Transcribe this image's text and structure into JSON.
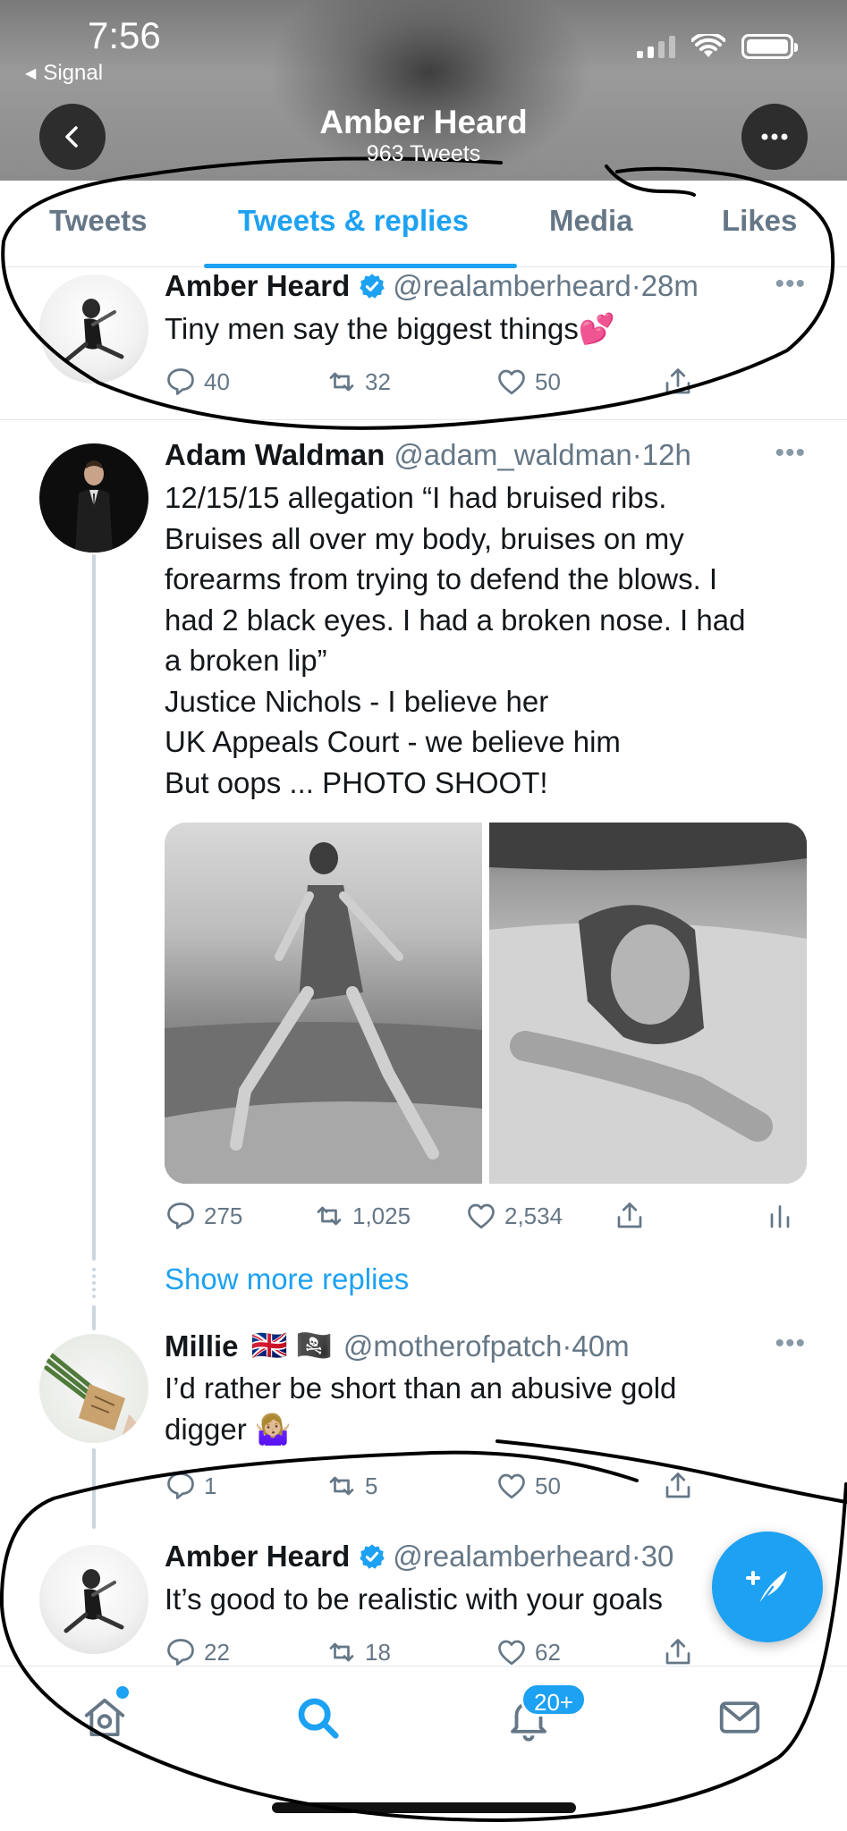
{
  "status_bar": {
    "time": "7:56",
    "back_app": "Signal"
  },
  "header": {
    "name": "Amber Heard",
    "tweet_count": "963 Tweets"
  },
  "tabs": [
    {
      "label": "Tweets",
      "active": false
    },
    {
      "label": "Tweets & replies",
      "active": true
    },
    {
      "label": "Media",
      "active": false
    },
    {
      "label": "Likes",
      "active": false
    }
  ],
  "tweets": [
    {
      "name": "Amber Heard",
      "verified": true,
      "handle": "@realamberheard",
      "time": "28m",
      "text": [
        "Tiny men say the biggest things💕"
      ],
      "replies": "40",
      "retweets": "32",
      "likes": "50"
    },
    {
      "name": "Adam Waldman",
      "verified": false,
      "handle": "@adam_waldman",
      "time": "12h",
      "text": [
        "12/15/15 allegation “I had bruised ribs.",
        "Bruises all over my body, bruises on my",
        "forearms from trying to defend the blows. I",
        "had 2 black eyes. I had a broken nose. I had",
        "a broken lip”",
        "Justice Nichols - I believe her",
        "UK Appeals Court - we believe him",
        "But oops ... PHOTO SHOOT!"
      ],
      "replies": "275",
      "retweets": "1,025",
      "likes": "2,534"
    },
    {
      "name": "Millie",
      "flags": "🇬🇧 🏴‍☠️",
      "verified": false,
      "handle": "@motherofpatch",
      "time": "40m",
      "text": [
        "I’d rather be short than an abusive gold",
        "digger 🤷🏼‍♀️"
      ],
      "replies": "1",
      "retweets": "5",
      "likes": "50"
    },
    {
      "name": "Amber Heard",
      "verified": true,
      "handle": "@realamberheard",
      "time": "30",
      "text": [
        "It’s good to be realistic with your goals"
      ],
      "replies": "22",
      "retweets": "18",
      "likes": "62"
    }
  ],
  "show_more": "Show more replies",
  "bottom_nav": {
    "notifications_badge": "20+"
  },
  "colors": {
    "accent": "#1da1f2",
    "secondary_text": "#657786",
    "annotation_ink": "#000000"
  }
}
